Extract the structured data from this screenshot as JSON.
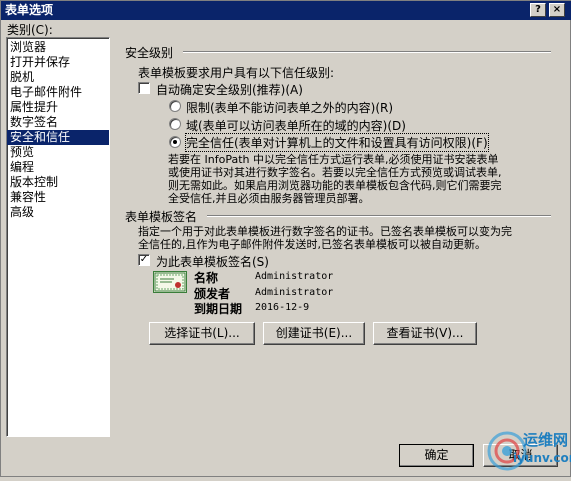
{
  "window": {
    "title": "表单选项",
    "help_btn": "?",
    "close_btn": "×"
  },
  "category": {
    "label": "类别(C):",
    "items": [
      "浏览器",
      "打开并保存",
      "脱机",
      "电子邮件附件",
      "属性提升",
      "数字签名",
      "安全和信任",
      "预览",
      "编程",
      "版本控制",
      "兼容性",
      "高级"
    ],
    "selected": "安全和信任"
  },
  "security": {
    "title": "安全级别",
    "require_text": "表单模板要求用户具有以下信任级别:",
    "auto_checkbox": "自动确定安全级别(推荐)(A)",
    "auto_checked": false,
    "options": [
      {
        "label": "限制(表单不能访问表单之外的内容)(R)",
        "selected": false
      },
      {
        "label": "域(表单可以访问表单所在的域的内容)(D)",
        "selected": false
      },
      {
        "label": "完全信任(表单对计算机上的文件和设置具有访问权限)(F)",
        "selected": true
      }
    ],
    "description": [
      "若要在 InfoPath 中以完全信任方式运行表单,必须使用证书安装表单",
      "或使用证书对其进行数字签名。若要以完全信任方式预览或调试表单,",
      "则无需如此。如果启用浏览器功能的表单模板包含代码,则它们需要完",
      "全受信任,并且必须由服务器管理员部署。"
    ]
  },
  "signing": {
    "title": "表单模板签名",
    "description": [
      "指定一个用于对此表单模板进行数字签名的证书。已签名表单模板可以变为完",
      "全信任的,且作为电子邮件附件发送时,已签名表单模板可以被自动更新。"
    ],
    "sign_checkbox": "为此表单模板签名(S)",
    "sign_checked": true,
    "cert": {
      "name_label": "名称",
      "name_value": "Administrator",
      "issuer_label": "颁发者",
      "issuer_value": "Administrator",
      "expiry_label": "到期日期",
      "expiry_value": "2016-12-9"
    },
    "buttons": {
      "select": "选择证书(L)...",
      "create": "创建证书(E)...",
      "view": "查看证书(V)..."
    }
  },
  "footer": {
    "ok": "确定",
    "cancel": "取消"
  },
  "watermark": {
    "text1": "运维网",
    "text2": "iyunv.com"
  }
}
